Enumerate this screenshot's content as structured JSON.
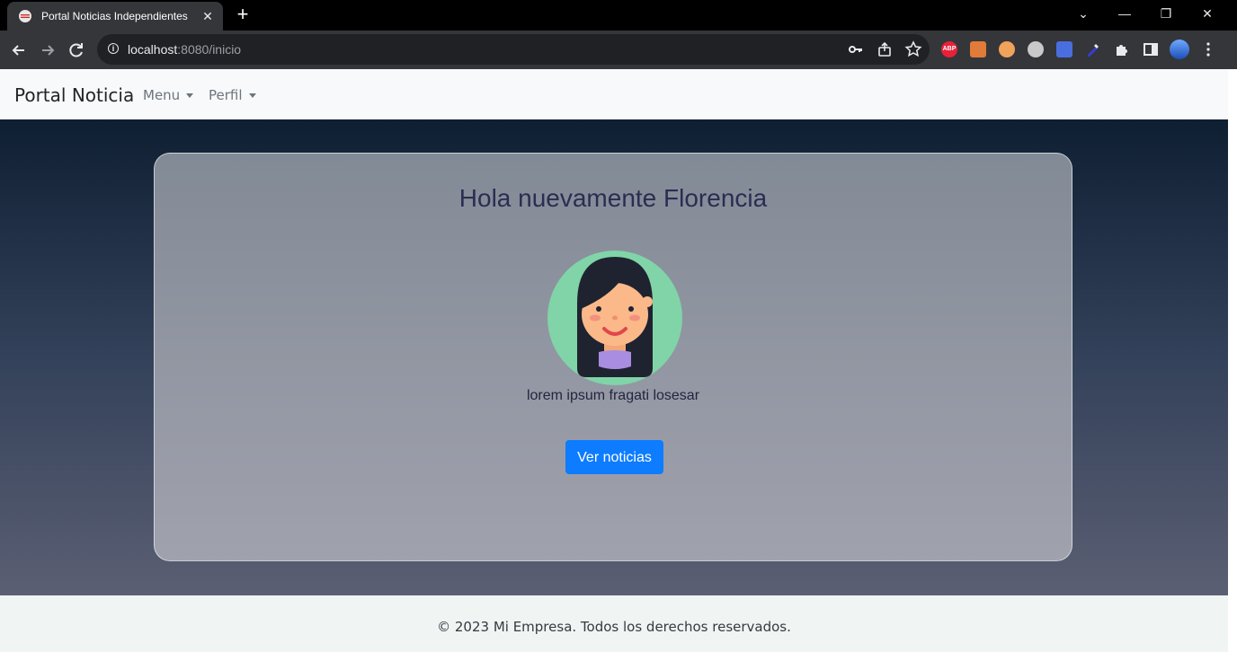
{
  "browser": {
    "tab_title": "Portal Noticias Independientes",
    "tab_close": "✕",
    "new_tab": "+",
    "url_host": "localhost",
    "url_rest": ":8080/inicio",
    "window_controls": {
      "minimize": "—",
      "restore": "❐",
      "close": "✕",
      "tabs_menu": "⌄"
    },
    "extensions": [
      {
        "name": "adblock-plus-icon",
        "text": "ABP",
        "color": "#e8213a"
      },
      {
        "name": "extension-icon-2",
        "text": "",
        "color": "#e07b39"
      },
      {
        "name": "extension-icon-3",
        "text": "",
        "color": "#f0a35a"
      },
      {
        "name": "extension-icon-4",
        "text": "",
        "color": "#c9c9c9"
      },
      {
        "name": "translate-icon",
        "text": "",
        "color": "#4a6ee0"
      },
      {
        "name": "eyedropper-icon",
        "text": "",
        "color": "#2a2a40"
      }
    ]
  },
  "navbar": {
    "brand": "Portal Noticia",
    "menu_label": "Menu",
    "profile_label": "Perfil"
  },
  "main": {
    "greeting": "Hola nuevamente Florencia",
    "subtitle": "lorem ipsum fragati losesar",
    "button_label": "Ver noticias",
    "button_color": "#0d7cff"
  },
  "footer": {
    "text": "© 2023 Mi Empresa. Todos los derechos reservados."
  }
}
